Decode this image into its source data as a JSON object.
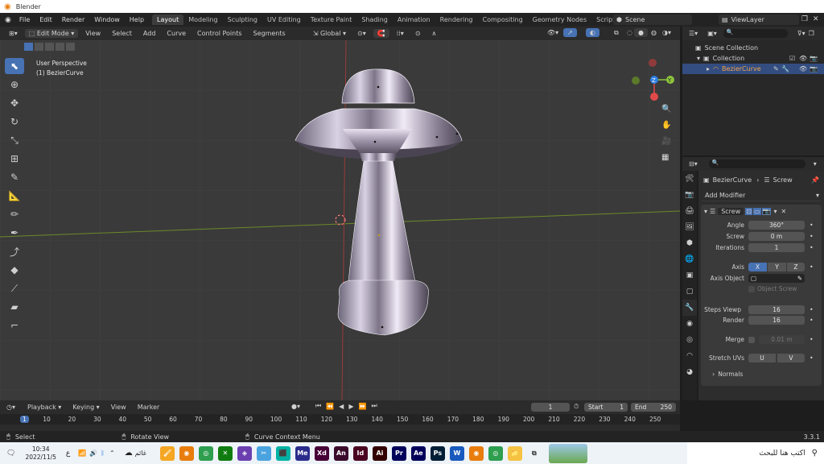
{
  "window": {
    "title": "Blender",
    "version": "3.3.1"
  },
  "menu": [
    "File",
    "Edit",
    "Render",
    "Window",
    "Help"
  ],
  "workspaces": [
    "Layout",
    "Modeling",
    "Sculpting",
    "UV Editing",
    "Texture Paint",
    "Shading",
    "Animation",
    "Rendering",
    "Compositing",
    "Geometry Nodes",
    "Scripting"
  ],
  "active_workspace": "Layout",
  "add_tab": "+",
  "scene": {
    "label": "Scene"
  },
  "view_layer": {
    "label": "ViewLayer"
  },
  "viewport_header": {
    "mode": "Edit Mode",
    "menus": [
      "View",
      "Select",
      "Add",
      "Curve",
      "Control Points",
      "Segments"
    ],
    "transform": "Global"
  },
  "viewport": {
    "perspective": "User Perspective",
    "object": "(1) BezierCurve",
    "gizmo": {
      "z": "Z",
      "y": "Y"
    }
  },
  "outliner": {
    "items": [
      {
        "label": "Scene Collection"
      },
      {
        "label": "Collection"
      },
      {
        "label": "BezierCurve"
      }
    ]
  },
  "properties": {
    "breadcrumb": {
      "object": "BezierCurve",
      "modifier": "Screw"
    },
    "add_modifier": "Add Modifier",
    "modifier_name": "Screw",
    "fields": {
      "angle": {
        "label": "Angle",
        "value": "360°"
      },
      "screw": {
        "label": "Screw",
        "value": "0 m"
      },
      "iterations": {
        "label": "Iterations",
        "value": "1"
      },
      "axis": {
        "label": "Axis",
        "options": [
          "X",
          "Y",
          "Z"
        ],
        "selected": "X"
      },
      "axis_object": {
        "label": "Axis Object"
      },
      "object_screw": {
        "label": "Object Screw"
      },
      "steps_viewport": {
        "label": "Steps Viewp",
        "value": "16"
      },
      "render": {
        "label": "Render",
        "value": "16"
      },
      "merge": {
        "label": "Merge",
        "value": "0.01 m"
      },
      "stretch_uvs": {
        "label": "Stretch UVs",
        "u": "U",
        "v": "V"
      },
      "normals": {
        "label": "Normals"
      }
    }
  },
  "timeline": {
    "menus": [
      "Playback",
      "Keying",
      "View",
      "Marker"
    ],
    "current_frame": "1",
    "start_label": "Start",
    "start": "1",
    "end_label": "End",
    "end": "250",
    "ticks": [
      "1",
      "10",
      "20",
      "30",
      "40",
      "50",
      "60",
      "70",
      "80",
      "90",
      "100",
      "110",
      "120",
      "130",
      "140",
      "150",
      "160",
      "170",
      "180",
      "190",
      "200",
      "210",
      "220",
      "230",
      "240",
      "250"
    ]
  },
  "status": {
    "select": "Select",
    "rotate": "Rotate View",
    "context": "Curve Context Menu",
    "version": "3.3.1"
  },
  "taskbar": {
    "time": "10:34",
    "date": "2022/11/5",
    "lang": "ع",
    "weather": "غائم",
    "search": "اكتب هنا للبحث",
    "apps": [
      {
        "name": "Me",
        "color": "#2b2b8c"
      },
      {
        "name": "Xd",
        "color": "#470137"
      },
      {
        "name": "An",
        "color": "#3b0b2c"
      },
      {
        "name": "Id",
        "color": "#49021f"
      },
      {
        "name": "Ai",
        "color": "#330000"
      },
      {
        "name": "Pr",
        "color": "#00005b"
      },
      {
        "name": "Ae",
        "color": "#00005b"
      },
      {
        "name": "Ps",
        "color": "#001e36"
      },
      {
        "name": "W",
        "color": "#185abd"
      }
    ]
  }
}
